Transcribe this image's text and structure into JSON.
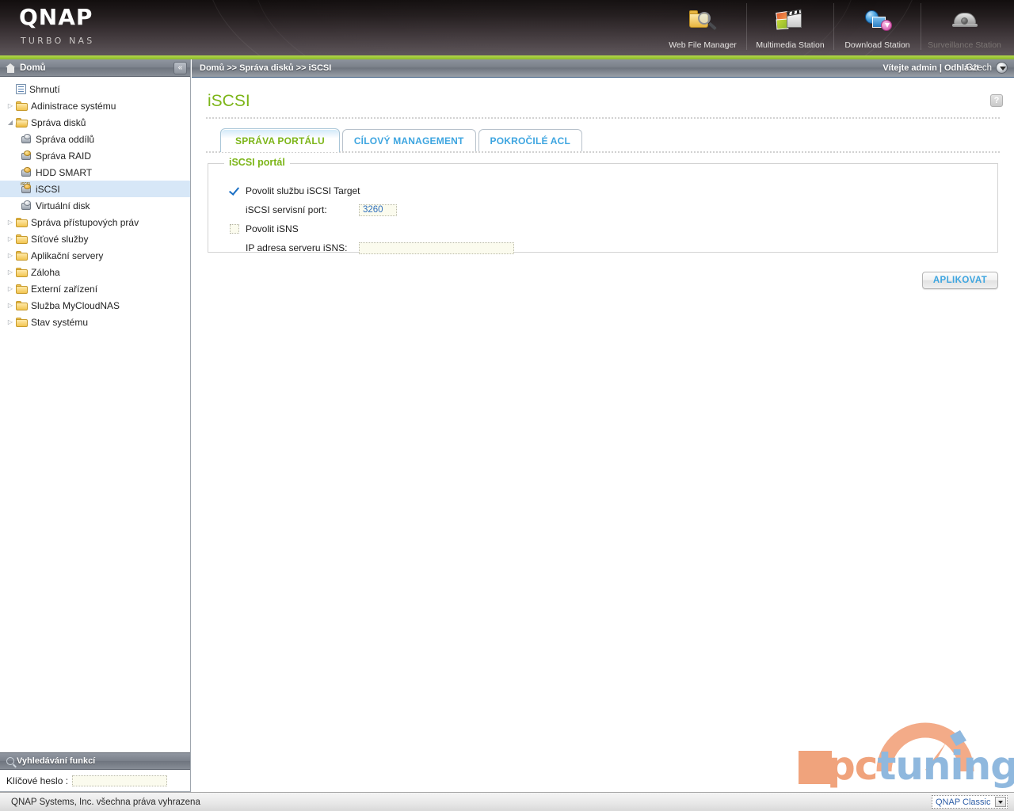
{
  "header": {
    "logo_main": "QNAP",
    "logo_sub": "TURBO NAS",
    "apps": [
      {
        "label": "Web File Manager",
        "icon": "web-file-manager-icon",
        "dim": false
      },
      {
        "label": "Multimedia Station",
        "icon": "multimedia-station-icon",
        "dim": false
      },
      {
        "label": "Download Station",
        "icon": "download-station-icon",
        "dim": false
      },
      {
        "label": "Surveillance Station",
        "icon": "surveillance-station-icon",
        "dim": true
      }
    ]
  },
  "sidebar": {
    "title": "Domů",
    "collapse_icon": "«",
    "items": [
      {
        "label": "Shrnutí",
        "icon": "summary-icon",
        "level": 1,
        "twisty": "",
        "selected": false
      },
      {
        "label": "Adinistrace systému",
        "icon": "folder-icon",
        "level": 1,
        "twisty": "▷",
        "selected": false
      },
      {
        "label": "Správa disků",
        "icon": "folder-open-icon",
        "level": 1,
        "twisty": "◢",
        "selected": false
      },
      {
        "label": "Správa oddílů",
        "icon": "disk-icon",
        "level": 2,
        "twisty": "",
        "selected": false
      },
      {
        "label": "Správa RAID",
        "icon": "raid-icon",
        "level": 2,
        "twisty": "",
        "selected": false
      },
      {
        "label": "HDD SMART",
        "icon": "hdd-smart-icon",
        "level": 2,
        "twisty": "",
        "selected": false
      },
      {
        "label": "iSCSI",
        "icon": "iscsi-icon",
        "level": 2,
        "twisty": "",
        "selected": true
      },
      {
        "label": "Virtuální disk",
        "icon": "virtual-disk-icon",
        "level": 2,
        "twisty": "",
        "selected": false
      },
      {
        "label": "Správa přístupových práv",
        "icon": "folder-icon",
        "level": 1,
        "twisty": "▷",
        "selected": false
      },
      {
        "label": "Síťové služby",
        "icon": "folder-icon",
        "level": 1,
        "twisty": "▷",
        "selected": false
      },
      {
        "label": "Aplikační servery",
        "icon": "folder-icon",
        "level": 1,
        "twisty": "▷",
        "selected": false
      },
      {
        "label": "Záloha",
        "icon": "folder-icon",
        "level": 1,
        "twisty": "▷",
        "selected": false
      },
      {
        "label": "Externí zařízení",
        "icon": "folder-icon",
        "level": 1,
        "twisty": "▷",
        "selected": false
      },
      {
        "label": "Služba MyCloudNAS",
        "icon": "folder-icon",
        "level": 1,
        "twisty": "▷",
        "selected": false
      },
      {
        "label": "Stav systému",
        "icon": "folder-icon",
        "level": 1,
        "twisty": "▷",
        "selected": false
      }
    ],
    "search": {
      "title": "Vyhledávání funkcí",
      "label": "Klíčové heslo :",
      "value": "",
      "placeholder": ""
    }
  },
  "breadcrumb": {
    "path": "Domů >> Správa disků >> iSCSI",
    "user": "Vítejte admin | Odhlásit",
    "language": "Czech"
  },
  "main": {
    "page_title": "iSCSI",
    "help_label": "?",
    "tabs": [
      {
        "label": "SPRÁVA PORTÁLU",
        "active": true
      },
      {
        "label": "CÍLOVÝ MANAGEMENT",
        "active": false
      },
      {
        "label": "POKROČILÉ ACL",
        "active": false
      }
    ],
    "panel": {
      "legend": "iSCSI portál",
      "enable_target": {
        "label": "Povolit službu iSCSI Target",
        "checked": true
      },
      "service_port": {
        "label": "iSCSI servisní port:",
        "value": "3260"
      },
      "enable_isns": {
        "label": "Povolit iSNS",
        "checked": false
      },
      "isns_address": {
        "label": "IP adresa serveru iSNS:",
        "value": ""
      }
    },
    "apply_button": "APLIKOVAT"
  },
  "watermark": {
    "text_pc": "pc",
    "text_tuning": "tuning"
  },
  "footer": {
    "copyright": "QNAP Systems, Inc. všechna práva vyhrazena",
    "theme": "QNAP Classic"
  },
  "colors": {
    "accent_green": "#7cb518",
    "accent_blue": "#3da5e0",
    "header_bar_green": "#9dc839",
    "selected_row": "#d7e7f7",
    "input_bg": "#fbfbee",
    "watermark_orange": "#f0a37c",
    "watermark_blue": "#8fb8de"
  }
}
